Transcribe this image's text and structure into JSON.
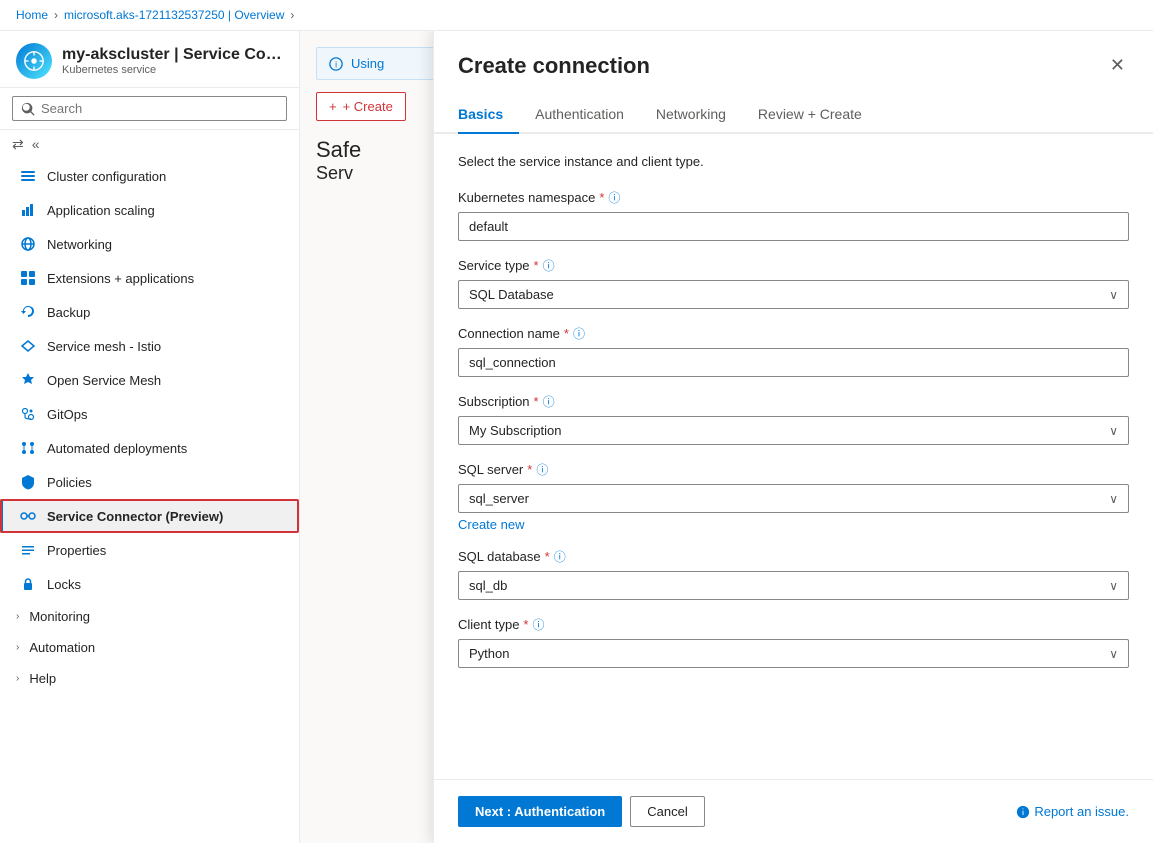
{
  "breadcrumb": {
    "items": [
      "Home",
      "microsoft.aks-1721132537250 | Overview"
    ],
    "separator": "›"
  },
  "sidebar": {
    "avatar_icon": "⎈",
    "title": "my-akscluster | Service Conn…",
    "subtitle": "Kubernetes service",
    "search_placeholder": "Search",
    "nav_items": [
      {
        "id": "cluster-configuration",
        "label": "Cluster configuration",
        "icon": "cluster"
      },
      {
        "id": "application-scaling",
        "label": "Application scaling",
        "icon": "scaling"
      },
      {
        "id": "networking",
        "label": "Networking",
        "icon": "networking"
      },
      {
        "id": "extensions-applications",
        "label": "Extensions + applications",
        "icon": "extensions"
      },
      {
        "id": "backup",
        "label": "Backup",
        "icon": "backup"
      },
      {
        "id": "service-mesh-istio",
        "label": "Service mesh - Istio",
        "icon": "mesh"
      },
      {
        "id": "open-service-mesh",
        "label": "Open Service Mesh",
        "icon": "osm"
      },
      {
        "id": "gitops",
        "label": "GitOps",
        "icon": "gitops"
      },
      {
        "id": "automated-deployments",
        "label": "Automated deployments",
        "icon": "deployments"
      },
      {
        "id": "policies",
        "label": "Policies",
        "icon": "policies"
      },
      {
        "id": "service-connector",
        "label": "Service Connector (Preview)",
        "icon": "connector",
        "active": true
      },
      {
        "id": "properties",
        "label": "Properties",
        "icon": "properties"
      },
      {
        "id": "locks",
        "label": "Locks",
        "icon": "locks"
      }
    ],
    "nav_groups": [
      {
        "id": "monitoring",
        "label": "Monitoring"
      },
      {
        "id": "automation",
        "label": "Automation"
      },
      {
        "id": "help",
        "label": "Help"
      }
    ]
  },
  "main_content": {
    "using_banner": "Using",
    "create_button": "+ Create",
    "safe_title": "Safe",
    "safe_subtitle": "Serv"
  },
  "panel": {
    "title": "Create connection",
    "close_icon": "✕",
    "tabs": [
      {
        "id": "basics",
        "label": "Basics",
        "active": true
      },
      {
        "id": "authentication",
        "label": "Authentication",
        "active": false
      },
      {
        "id": "networking",
        "label": "Networking",
        "active": false
      },
      {
        "id": "review-create",
        "label": "Review + Create",
        "active": false
      }
    ],
    "description": "Select the service instance and client type.",
    "fields": {
      "kubernetes_namespace": {
        "label": "Kubernetes namespace",
        "required": true,
        "value": "default",
        "type": "text"
      },
      "service_type": {
        "label": "Service type",
        "required": true,
        "value": "SQL Database",
        "type": "select"
      },
      "connection_name": {
        "label": "Connection name",
        "required": true,
        "value": "sql_connection",
        "type": "text"
      },
      "subscription": {
        "label": "Subscription",
        "required": true,
        "value": "My Subscription",
        "type": "select"
      },
      "sql_server": {
        "label": "SQL server",
        "required": true,
        "value": "sql_server",
        "type": "select",
        "create_new_link": "Create new"
      },
      "sql_database": {
        "label": "SQL database",
        "required": true,
        "value": "sql_db",
        "type": "select"
      },
      "client_type": {
        "label": "Client type",
        "required": true,
        "value": "Python",
        "type": "select"
      }
    },
    "footer": {
      "next_button": "Next : Authentication",
      "cancel_button": "Cancel",
      "report_link": "Report an issue."
    }
  }
}
